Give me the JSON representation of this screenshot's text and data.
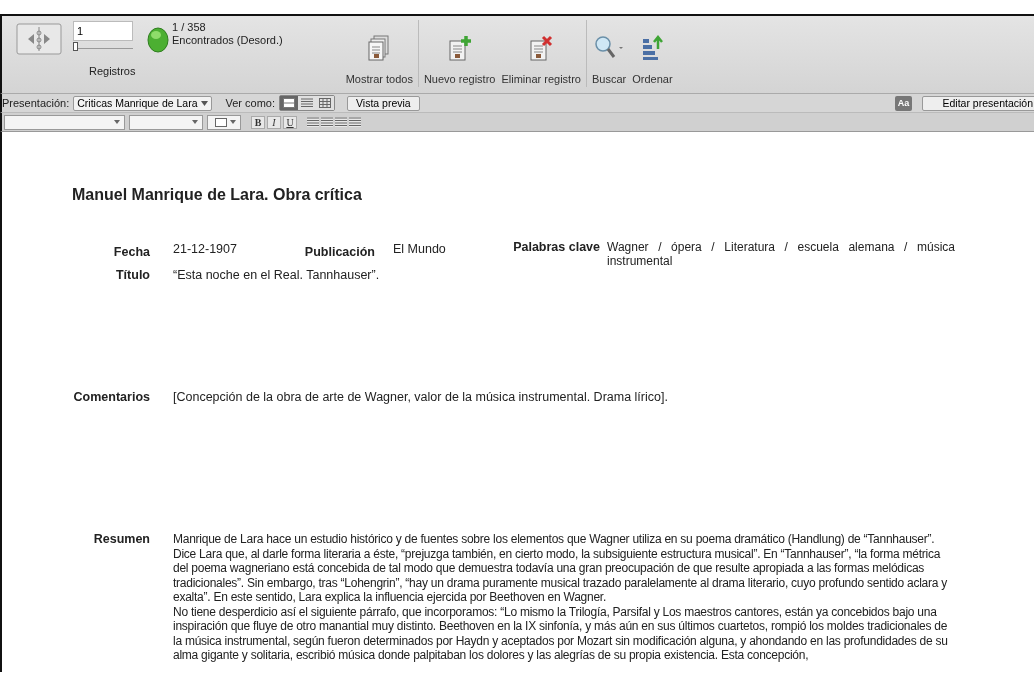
{
  "toolbar": {
    "record_number": "1",
    "record_slider": {
      "level": 0
    },
    "found_count": "1 / 358",
    "found_status": "Encontrados (Desord.)",
    "records_label": "Registros",
    "buttons": [
      {
        "kind": "show-all",
        "label": "Mostrar todos"
      },
      {
        "kind": "new",
        "label": "Nuevo registro"
      },
      {
        "kind": "delete",
        "label": "Eliminar registro"
      },
      {
        "kind": "find",
        "label": "Buscar"
      },
      {
        "kind": "sort",
        "label": "Ordenar"
      }
    ]
  },
  "layout_bar": {
    "layout_label": "Presentación:",
    "layout": "Criticas Manrique de Lara",
    "view_label": "Ver como:",
    "views": [
      {
        "kind": "form",
        "selected": true
      },
      {
        "kind": "list",
        "selected": false
      },
      {
        "kind": "table",
        "selected": false
      }
    ],
    "preview_button": "Vista previa",
    "format_icon": "Aa",
    "edit_button": "Editar presentación"
  },
  "format_bar": {
    "styles": [
      "B",
      "I",
      "U"
    ]
  },
  "record": {
    "title": "Manuel Manrique de Lara. Obra crítica",
    "fecha": {
      "label": "Fecha",
      "value": "21-12-1907"
    },
    "publicacion": {
      "label": "Publicación",
      "value": "El Mundo"
    },
    "palabras": {
      "label": "Palabras clave",
      "value": "Wagner / ópera / Literatura / escuela alemana / música instrumental"
    },
    "titulo": {
      "label": "Título",
      "value": "“Esta noche en el Real. Tannhauser”."
    },
    "comentarios": {
      "label": "Comentarios",
      "value": "[Concepción de la obra de arte de Wagner, valor de la música instrumental. Drama lírico]."
    },
    "resumen": {
      "label": "Resumen",
      "paragraphs": [
        "Manrique de Lara hace un estudio histórico y de fuentes sobre los elementos que Wagner utiliza en su poema dramático (Handlung) de “Tannhauser”. Dice Lara que, al darle forma literaria a éste, “prejuzga también, en cierto modo, la subsiguiente estructura musical”. En “Tannhauser”, “la forma métrica del poema wagneriano está concebida de tal modo que demuestra todavía una gran preocupación de que resulte apropiada a las formas melódicas tradicionales”. Sin embargo, tras “Lohengrin”, “hay un drama puramente musical trazado paralelamente al drama literario, cuyo profundo sentido aclara y exalta”. En este sentido, Lara explica la influencia ejercida por Beethoven en Wagner.",
        "No tiene desperdicio así el siguiente párrafo, que incorporamos: “Lo mismo la Trilogía, Parsifal y Los maestros cantores, están ya concebidos bajo una inspiración que fluye de otro manantial muy distinto. Beethoven en la IX sinfonía, y más aún en sus últimos cuartetos, rompió los moldes tradicionales de la música instrumental, según fueron determinados por Haydn y aceptados por Mozart sin modificación alguna, y ahondando en las profundidades de su alma gigante y solitaria, escribió música donde palpitaban los dolores y las alegrías de su propia existencia. Esta concepción,"
      ]
    }
  }
}
